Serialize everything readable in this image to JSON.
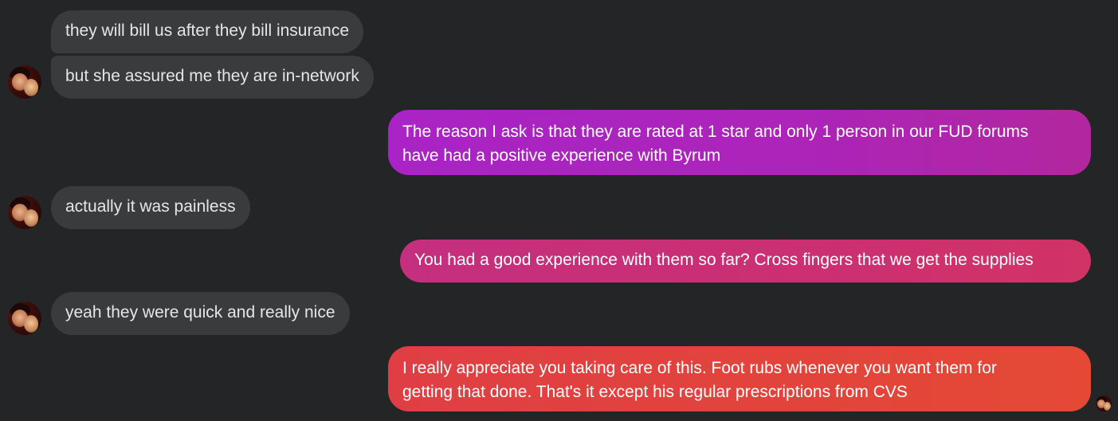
{
  "messages": [
    {
      "side": "in",
      "text": "they will bill us after they bill insurance"
    },
    {
      "side": "in",
      "text": "but she assured me they are in-network"
    },
    {
      "side": "out",
      "lines": [
        "The reason I ask is that they are rated at 1 star and only 1 person in our FUD forums",
        "have had a positive experience with Byrum"
      ]
    },
    {
      "side": "in",
      "text": "actually it was painless"
    },
    {
      "side": "out",
      "text": "You had a good experience with them so far?  Cross fingers that we get the supplies"
    },
    {
      "side": "in",
      "text": "yeah they were quick and really nice"
    },
    {
      "side": "out",
      "lines": [
        "I really appreciate you taking care of this.  Foot rubs whenever you want them for",
        "getting that done.  That's it except his regular prescriptions from CVS"
      ]
    }
  ],
  "colors": {
    "background": "#242526",
    "incoming_bubble": "#3a3b3c",
    "outgoing_1": "#a625c4",
    "outgoing_2": "#cc2f74",
    "outgoing_3": "#e0413b"
  },
  "icons": {
    "contact_avatar": "contact-avatar-icon",
    "seen_avatar": "seen-avatar-icon"
  }
}
